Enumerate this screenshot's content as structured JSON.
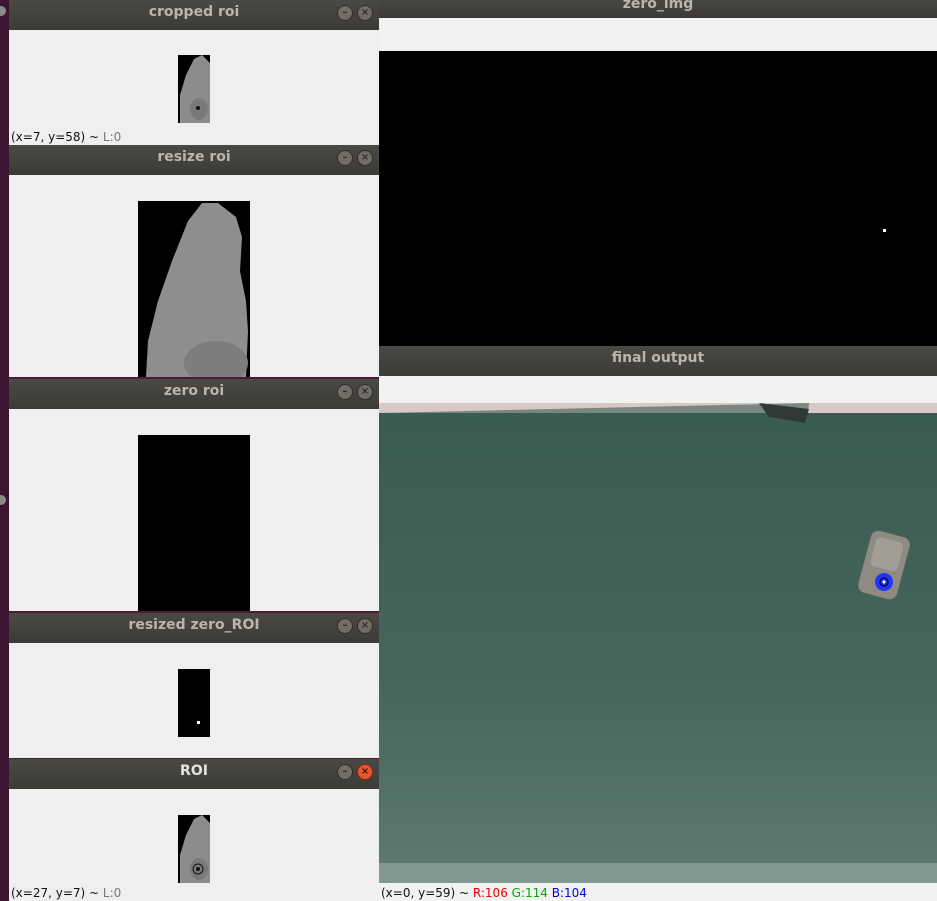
{
  "windows": {
    "cropped_roi": {
      "title": "cropped roi",
      "status": "(x=7, y=58) ~ ",
      "status_label": "L:0"
    },
    "resize_roi": {
      "title": "resize roi"
    },
    "zero_roi": {
      "title": "zero roi"
    },
    "resized_zero_roi": {
      "title": "resized zero_ROI"
    },
    "roi": {
      "title": "ROI",
      "status": "(x=27, y=7) ~ ",
      "status_label": "L:0"
    },
    "zero_img": {
      "title": "zero_img"
    },
    "final_output": {
      "title": "final output",
      "status": "(x=0, y=59) ~ ",
      "r": "R:106",
      "g": "G:114",
      "b": "B:104"
    }
  },
  "icons": {
    "minimize": "minimize-icon",
    "close": "close-icon"
  },
  "colors": {
    "titlebar": "#3c3b37",
    "close_active": "#e8572c",
    "desktop": "#4a1a3a",
    "table": "#3e5e55"
  }
}
